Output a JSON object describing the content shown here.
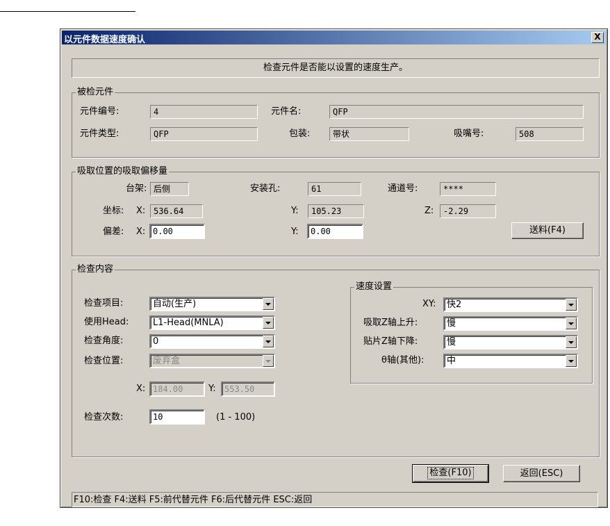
{
  "window": {
    "title": "以元件数据速度确认",
    "close_label": "X"
  },
  "message": "检查元件是否能以设置的速度生产。",
  "checked_part": {
    "group_label": "被检元件",
    "part_no_label": "元件编号:",
    "part_no": "4",
    "part_name_label": "元件名:",
    "part_name": "QFP",
    "part_type_label": "元件类型:",
    "part_type": "QFP",
    "package_label": "包装:",
    "package": "带状",
    "nozzle_label": "吸嘴号:",
    "nozzle": "508"
  },
  "pickup": {
    "group_label": "吸取位置的吸取偏移量",
    "rack_label": "台架:",
    "rack": "后侧",
    "hole_label": "安装孔:",
    "hole": "61",
    "channel_label": "通道号:",
    "channel": "****",
    "coord_label": "坐标:",
    "coord_x_label": "X:",
    "coord_x": "536.64",
    "coord_y_label": "Y:",
    "coord_y": "105.23",
    "coord_z_label": "Z:",
    "coord_z": "-2.29",
    "offset_label": "偏差:",
    "offset_x_label": "X:",
    "offset_x": "0.00",
    "offset_y_label": "Y:",
    "offset_y": "0.00",
    "feed_button": "送料(F4)"
  },
  "inspection": {
    "group_label": "检查内容",
    "item_label": "检查项目:",
    "item_value": "自动(生产)",
    "head_label": "使用Head:",
    "head_value": "L1-Head(MNLA)",
    "angle_label": "检查角度:",
    "angle_value": "0",
    "position_label": "检查位置:",
    "position_value": "废弃盒",
    "pos_x_label": "X:",
    "pos_x": "184.00",
    "pos_y_label": "Y:",
    "pos_y": "553.50",
    "count_label": "检查次数:",
    "count_value": "10",
    "count_range": "(1 - 100)"
  },
  "speed": {
    "group_label": "速度设置",
    "xy_label": "XY:",
    "xy_value": "快2",
    "pick_z_label": "吸取Z轴上升:",
    "pick_z_value": "慢",
    "place_z_label": "贴片Z轴下降:",
    "place_z_value": "慢",
    "theta_label": "θ轴(其他):",
    "theta_value": "中"
  },
  "buttons": {
    "check": "检查(F10)",
    "back": "返回(ESC)"
  },
  "status_bar": "F10:检查  F4:送料  F5:前代替元件  F6:后代替元件  ESC:返回"
}
